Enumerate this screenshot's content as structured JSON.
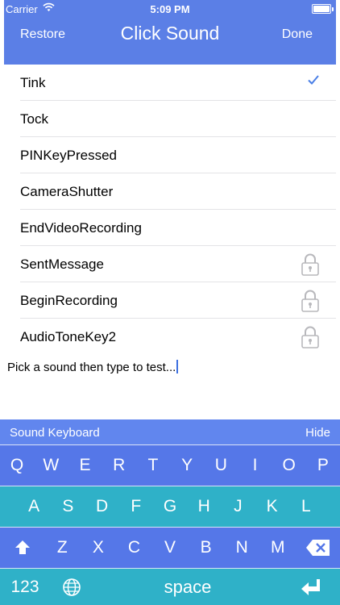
{
  "status_bar": {
    "carrier": "Carrier",
    "time": "5:09 PM"
  },
  "nav": {
    "left": "Restore",
    "title": "Click Sound",
    "right": "Done"
  },
  "sounds": [
    {
      "label": "Tink",
      "selected": true,
      "locked": false
    },
    {
      "label": "Tock",
      "selected": false,
      "locked": false
    },
    {
      "label": "PINKeyPressed",
      "selected": false,
      "locked": false
    },
    {
      "label": "CameraShutter",
      "selected": false,
      "locked": false
    },
    {
      "label": "EndVideoRecording",
      "selected": false,
      "locked": false
    },
    {
      "label": "SentMessage",
      "selected": false,
      "locked": true
    },
    {
      "label": "BeginRecording",
      "selected": false,
      "locked": true
    },
    {
      "label": "AudioToneKey2",
      "selected": false,
      "locked": true
    }
  ],
  "test_field": {
    "text": "Pick a sound then type to test..."
  },
  "keyboard": {
    "title": "Sound Keyboard",
    "hide": "Hide",
    "row1": [
      "Q",
      "W",
      "E",
      "R",
      "T",
      "Y",
      "U",
      "I",
      "O",
      "P"
    ],
    "row2": [
      "A",
      "S",
      "D",
      "F",
      "G",
      "H",
      "J",
      "K",
      "L"
    ],
    "row3": [
      "Z",
      "X",
      "C",
      "V",
      "B",
      "N",
      "M"
    ],
    "numbers": "123",
    "space": "space"
  },
  "colors": {
    "header": "#5b7fe6",
    "key_blue": "#5577e8",
    "key_teal": "#2fb1c8",
    "check": "#4a7fe6"
  }
}
